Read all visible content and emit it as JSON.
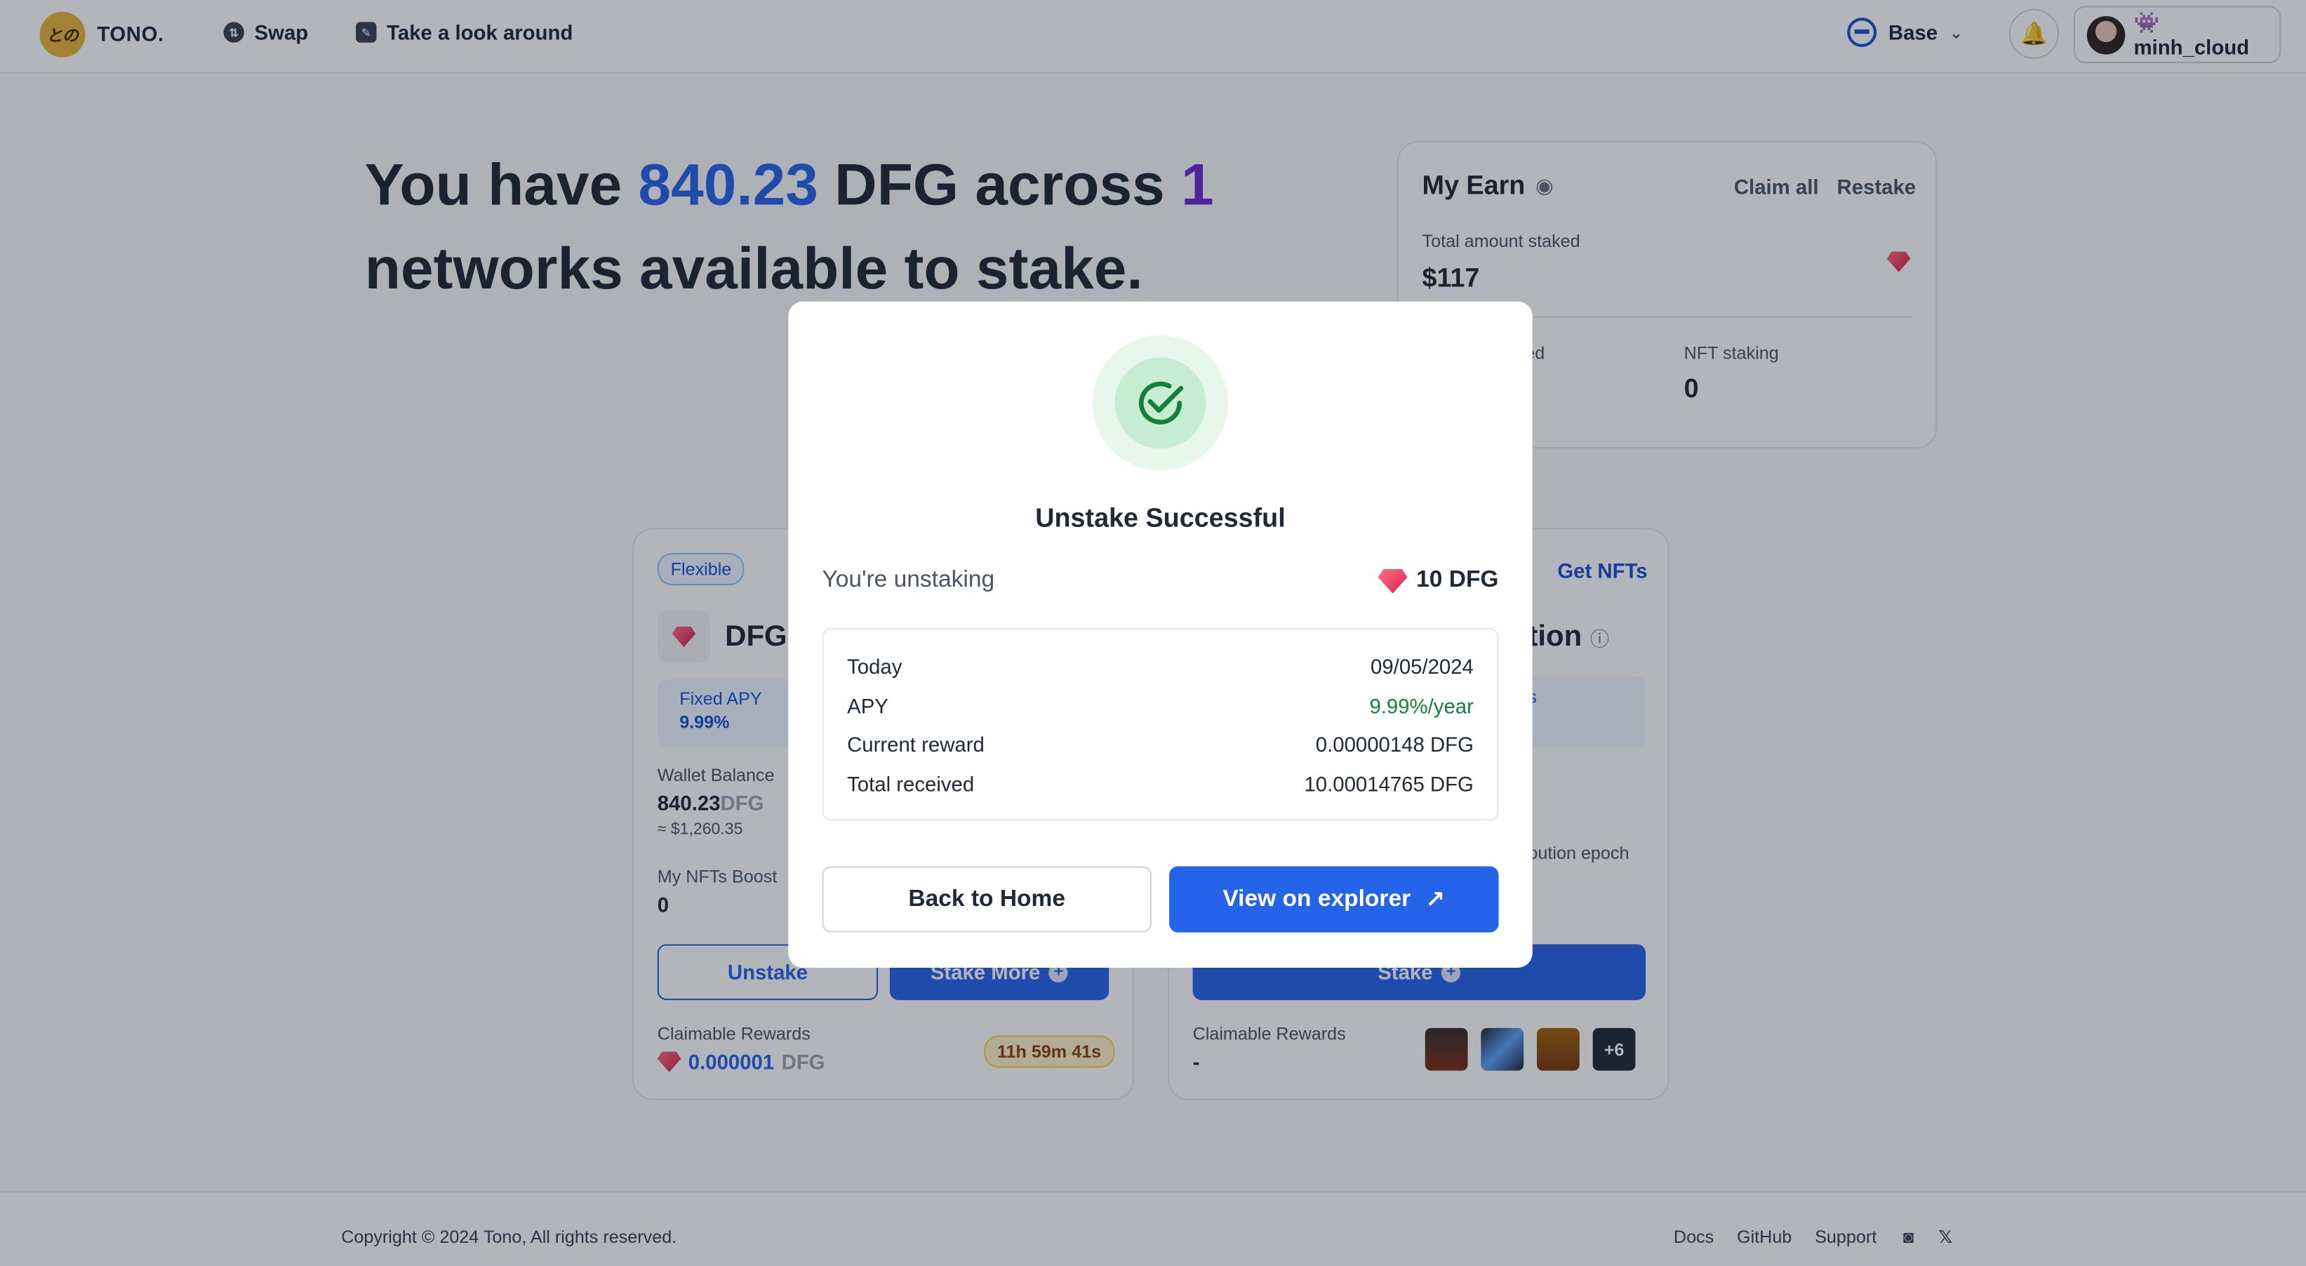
{
  "header": {
    "logo_text": "TONO.",
    "logo_mark": "との",
    "nav": [
      {
        "label": "Swap",
        "icon": "swap-icon"
      },
      {
        "label": "Take a look around",
        "icon": "explore-icon"
      }
    ],
    "network": "Base",
    "username": "👾 minh_cloud"
  },
  "hero": {
    "part1": "You have ",
    "amount": "840.23",
    "part2": " DFG across ",
    "count": "1",
    "part3": " networks available to stake."
  },
  "earn": {
    "title": "My Earn",
    "claim_all": "Claim all",
    "restake": "Restake",
    "total_staked_label": "Total amount staked",
    "total_staked_value": "$117",
    "partial_label": "ed",
    "nft_staking_label": "NFT staking",
    "nft_staking_value": "0"
  },
  "pool_left": {
    "tag": "Flexible",
    "token": "DFG",
    "apy_label": "Fixed APY",
    "apy_value": "9.99%",
    "wallet_label": "Wallet Balance",
    "wallet_value": "840.23",
    "wallet_unit": "DFG",
    "wallet_usd": "≈ $1,260.35",
    "boost_label": "My NFTs Boost",
    "boost_value": "0",
    "unstake": "Unstake",
    "stake_more": "Stake More",
    "claim_label": "Claimable Rewards",
    "claim_value": "0.000001",
    "claim_unit": "DFG",
    "timer": "11h 59m 41s"
  },
  "pool_right": {
    "get_nfts": "Get NFTs",
    "title_frag": "tion",
    "info_frag": "s",
    "epoch_frag": "oution epoch",
    "stake": "Stake",
    "claim_label": "Claimable Rewards",
    "claim_value": "-",
    "more_count": "+6"
  },
  "modal": {
    "title": "Unstake Successful",
    "unstaking_label": "You're unstaking",
    "unstaking_value": "10 DFG",
    "rows": [
      {
        "label": "Today",
        "value": "09/05/2024"
      },
      {
        "label": "APY",
        "value": "9.99%/year"
      },
      {
        "label": "Current reward",
        "value": "0.00000148 DFG"
      },
      {
        "label": "Total received",
        "value": "10.00014765 DFG"
      }
    ],
    "back_label": "Back to Home",
    "explorer_label": "View on explorer"
  },
  "footer": {
    "copyright": "Copyright © 2024 Tono, All rights reserved.",
    "links": [
      "Docs",
      "GitHub",
      "Support"
    ]
  },
  "colors": {
    "accent": "#2563eb",
    "success": "#15803d",
    "purple": "#6d28d9"
  }
}
